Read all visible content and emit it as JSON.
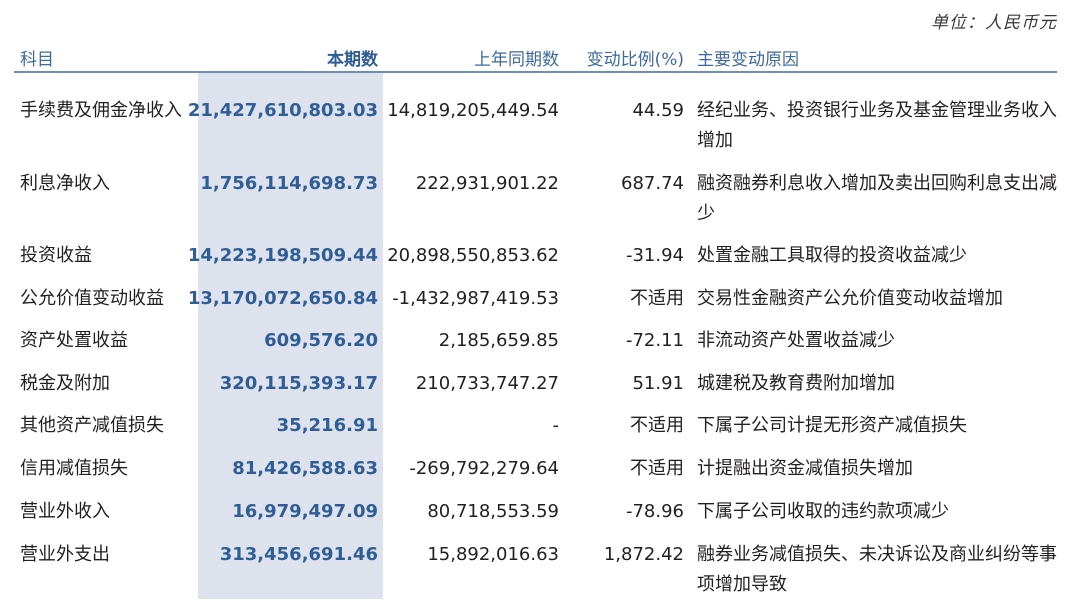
{
  "unit_label": "单位：人民币元",
  "headers": {
    "subject": "科目",
    "current": "本期数",
    "prior": "上年同期数",
    "change": "变动比例(%)",
    "reason": "主要变动原因"
  },
  "rows": [
    {
      "subject": "手续费及佣金净收入",
      "current": "21,427,610,803.03",
      "prior": "14,819,205,449.54",
      "change": "44.59",
      "reason": "经纪业务、投资银行业务及基金管理业务收入增加"
    },
    {
      "subject": "利息净收入",
      "current": "1,756,114,698.73",
      "prior": "222,931,901.22",
      "change": "687.74",
      "reason": "融资融券利息收入增加及卖出回购利息支出减少"
    },
    {
      "subject": "投资收益",
      "current": "14,223,198,509.44",
      "prior": "20,898,550,853.62",
      "change": "-31.94",
      "reason": "处置金融工具取得的投资收益减少"
    },
    {
      "subject": "公允价值变动收益",
      "current": "13,170,072,650.84",
      "prior": "-1,432,987,419.53",
      "change": "不适用",
      "reason": "交易性金融资产公允价值变动收益增加"
    },
    {
      "subject": "资产处置收益",
      "current": "609,576.20",
      "prior": "2,185,659.85",
      "change": "-72.11",
      "reason": "非流动资产处置收益减少"
    },
    {
      "subject": "税金及附加",
      "current": "320,115,393.17",
      "prior": "210,733,747.27",
      "change": "51.91",
      "reason": "城建税及教育费附加增加"
    },
    {
      "subject": "其他资产减值损失",
      "current": "35,216.91",
      "prior": "-",
      "change": "不适用",
      "reason": "下属子公司计提无形资产减值损失"
    },
    {
      "subject": "信用减值损失",
      "current": "81,426,588.63",
      "prior": "-269,792,279.64",
      "change": "不适用",
      "reason": "计提融出资金减值损失增加"
    },
    {
      "subject": "营业外收入",
      "current": "16,979,497.09",
      "prior": "80,718,553.59",
      "change": "-78.96",
      "reason": "下属子公司收取的违约款项减少"
    },
    {
      "subject": "营业外支出",
      "current": "313,456,691.46",
      "prior": "15,892,016.63",
      "change": "1,872.42",
      "reason": "融券业务减值损失、未决诉讼及商业纠纷等事项增加导致"
    }
  ]
}
